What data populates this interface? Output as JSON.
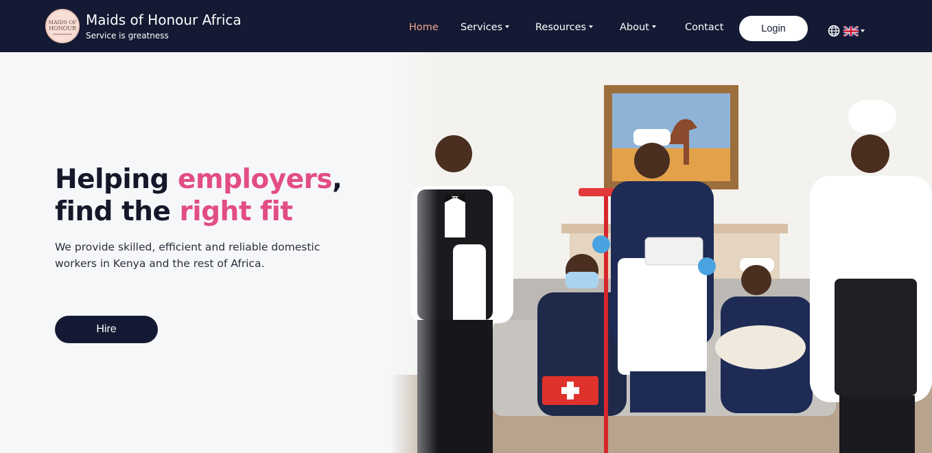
{
  "brand": {
    "name": "Maids of Honour Africa",
    "tagline": "Service is greatness",
    "logo_text_1": "MAIDS OF",
    "logo_text_2": "HONOUR"
  },
  "nav": {
    "home": "Home",
    "services": "Services",
    "resources": "Resources",
    "about": "About",
    "contact": "Contact",
    "login": "Login",
    "language_icon": "globe-icon",
    "flag_icon": "uk-flag-icon"
  },
  "hero": {
    "headline_1a": "Helping ",
    "headline_1b": "employers",
    "headline_1c": ",",
    "headline_2a": "find the ",
    "headline_2b": "right fit",
    "subtext": "We provide skilled, efficient and reliable domestic workers in Kenya and the rest of Africa.",
    "cta": "Hire"
  },
  "colors": {
    "navy": "#141a33",
    "accent_pink": "#e24d84",
    "active_nav": "#f1a48e"
  }
}
